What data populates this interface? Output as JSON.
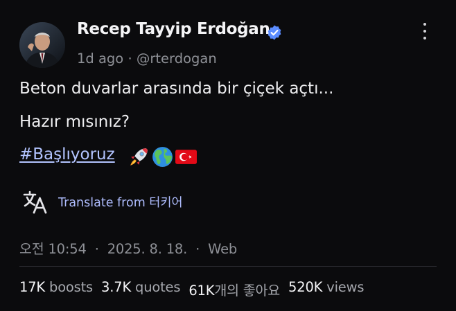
{
  "author": {
    "name": "Recep Tayyip Erdoğan",
    "time_ago": "1d ago",
    "dot": "·",
    "handle": "@rterdogan",
    "verified_color": "#5b8cff"
  },
  "post": {
    "line1": "Beton duvarlar arasında bir çiçek açtı...",
    "line2": "Hazır mısınız?",
    "hashtag": "#Başlıyoruz",
    "emojis": [
      "rocket-icon",
      "globe-americas-icon",
      "turkey-flag-icon"
    ]
  },
  "translate": {
    "label": "Translate from 터키어",
    "icon": "translate-icon",
    "color": "#aebcfd"
  },
  "timestamp": {
    "time": "오전 10:54",
    "date": "2025. 8. 18.",
    "source": "Web",
    "dot": "·"
  },
  "stats": {
    "boosts_count": "17K",
    "boosts_label": "boosts",
    "quotes_count": "3.7K",
    "quotes_label": "quotes",
    "likes_count": "61K",
    "likes_label": "개의 좋아요",
    "views_count": "520K",
    "views_label": "views"
  }
}
